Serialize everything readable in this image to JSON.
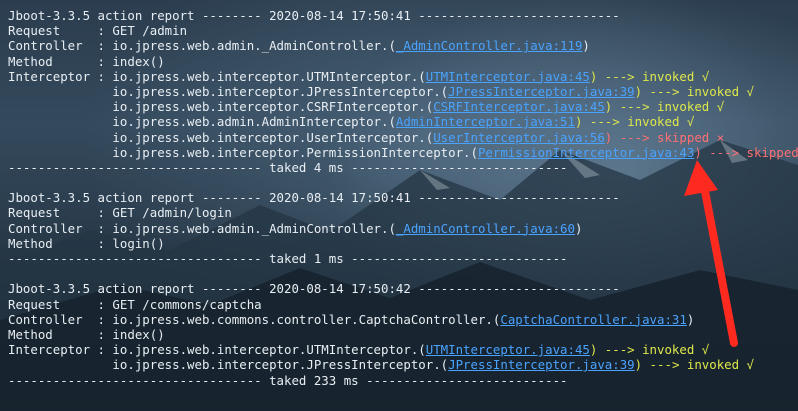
{
  "colors": {
    "text": "#e8eef3",
    "link": "#4aa3ff",
    "invoked": "#dfe84a",
    "skipped": "#ff6f73",
    "annotation_arrow": "#ff2a1f"
  },
  "reports": [
    {
      "header_left": "Jboot-3.3.5 action report -------- ",
      "header_date": "2020-08-14 17:50:41",
      "header_right": " ---------------------------",
      "request": "Request     : GET /admin",
      "controller_prefix": "Controller  : io.jpress.web.admin._AdminController.(",
      "controller_link": "_AdminController.java:119",
      "controller_suffix": ")",
      "method": "Method      : index()",
      "interceptors": [
        {
          "prefix": "Interceptor : io.jpress.web.interceptor.UTMInterceptor.(",
          "link": "UTMInterceptor.java:45",
          "suffix": ") ---> ",
          "status": "invoked √",
          "type": "invoked"
        },
        {
          "prefix": "              io.jpress.web.interceptor.JPressInterceptor.(",
          "link": "JPressInterceptor.java:39",
          "suffix": ") ---> ",
          "status": "invoked √",
          "type": "invoked"
        },
        {
          "prefix": "              io.jpress.web.interceptor.CSRFInterceptor.(",
          "link": "CSRFInterceptor.java:45",
          "suffix": ") ---> ",
          "status": "invoked √",
          "type": "invoked"
        },
        {
          "prefix": "              io.jpress.web.admin.AdminInterceptor.(",
          "link": "AdminInterceptor.java:51",
          "suffix": ") ---> ",
          "status": "invoked √",
          "type": "invoked"
        },
        {
          "prefix": "              io.jpress.web.interceptor.UserInterceptor.(",
          "link": "UserInterceptor.java:56",
          "suffix": ") ---> ",
          "status": "skipped ×",
          "type": "skipped"
        },
        {
          "prefix": "              io.jpress.web.interceptor.PermissionInterceptor.(",
          "link": "PermissionInterceptor.java:43",
          "suffix": ") ---> ",
          "status": "skipped ×",
          "type": "skipped"
        }
      ],
      "footer": "---------------------------------- taked 4 ms -----------------------------"
    },
    {
      "header_left": "Jboot-3.3.5 action report -------- ",
      "header_date": "2020-08-14 17:50:41",
      "header_right": " ---------------------------",
      "request": "Request     : GET /admin/login",
      "controller_prefix": "Controller  : io.jpress.web.admin._AdminController.(",
      "controller_link": "_AdminController.java:60",
      "controller_suffix": ")",
      "method": "Method      : login()",
      "interceptors": [],
      "footer": "---------------------------------- taked 1 ms -----------------------------"
    },
    {
      "header_left": "Jboot-3.3.5 action report -------- ",
      "header_date": "2020-08-14 17:50:42",
      "header_right": " ---------------------------",
      "request": "Request     : GET /commons/captcha",
      "controller_prefix": "Controller  : io.jpress.web.commons.controller.CaptchaController.(",
      "controller_link": "CaptchaController.java:31",
      "controller_suffix": ")",
      "method": "Method      : index()",
      "interceptors": [
        {
          "prefix": "Interceptor : io.jpress.web.interceptor.UTMInterceptor.(",
          "link": "UTMInterceptor.java:45",
          "suffix": ") ---> ",
          "status": "invoked √",
          "type": "invoked"
        },
        {
          "prefix": "              io.jpress.web.interceptor.JPressInterceptor.(",
          "link": "JPressInterceptor.java:39",
          "suffix": ") ---> ",
          "status": "invoked √",
          "type": "invoked"
        }
      ],
      "footer": "---------------------------------- taked 233 ms ---------------------------"
    }
  ]
}
